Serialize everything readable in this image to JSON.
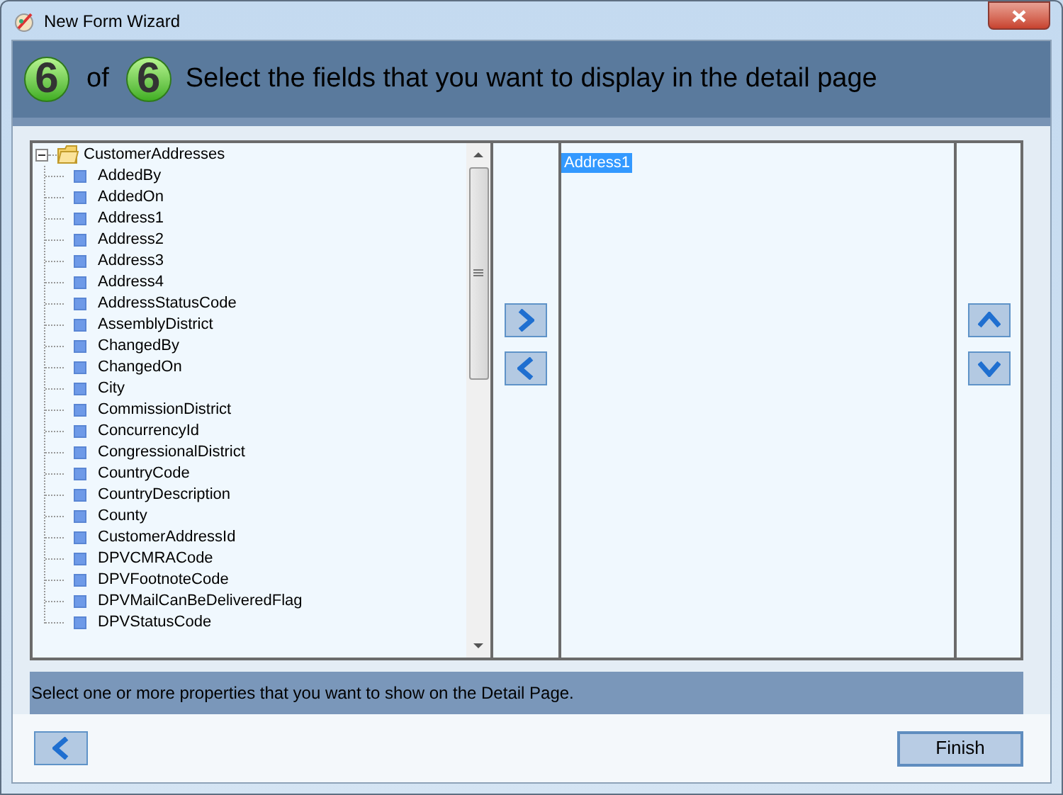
{
  "window": {
    "title": "New Form Wizard"
  },
  "header": {
    "step": "6",
    "of": "of",
    "total": "6",
    "title": "Select the fields that you want to display in the detail page"
  },
  "tree": {
    "label": "CustomerAddresses",
    "expanded": true,
    "children": [
      {
        "label": "AddedBy"
      },
      {
        "label": "AddedOn"
      },
      {
        "label": "Address1"
      },
      {
        "label": "Address2"
      },
      {
        "label": "Address3"
      },
      {
        "label": "Address4"
      },
      {
        "label": "AddressStatusCode"
      },
      {
        "label": "AssemblyDistrict"
      },
      {
        "label": "ChangedBy"
      },
      {
        "label": "ChangedOn"
      },
      {
        "label": "City"
      },
      {
        "label": "CommissionDistrict"
      },
      {
        "label": "ConcurrencyId"
      },
      {
        "label": "CongressionalDistrict"
      },
      {
        "label": "CountryCode"
      },
      {
        "label": "CountryDescription"
      },
      {
        "label": "County"
      },
      {
        "label": "CustomerAddressId"
      },
      {
        "label": "DPVCMRACode"
      },
      {
        "label": "DPVFootnoteCode"
      },
      {
        "label": "DPVMailCanBeDeliveredFlag"
      },
      {
        "label": "DPVStatusCode"
      }
    ]
  },
  "selected_fields": [
    {
      "label": "Address1",
      "selected": true
    }
  ],
  "status": "Select one or more properties that you want to show on the Detail Page.",
  "finish_button": "Finish"
}
